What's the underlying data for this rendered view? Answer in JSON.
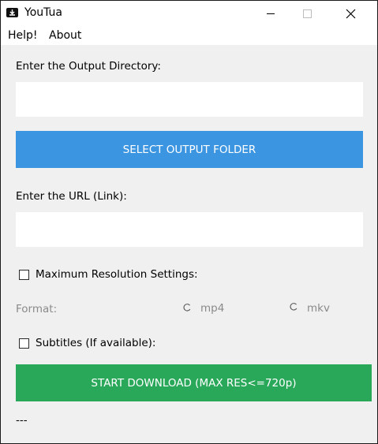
{
  "window": {
    "title": "YouTua"
  },
  "menu": {
    "items": [
      "Help!",
      "About"
    ]
  },
  "output_dir": {
    "label": "Enter the Output Directory:",
    "value": "",
    "button_label": "SELECT OUTPUT FOLDER"
  },
  "url": {
    "label": "Enter the URL (Link):",
    "value": ""
  },
  "max_res": {
    "label": "Maximum Resolution Settings:",
    "checked": false
  },
  "format": {
    "label": "Format:",
    "options": [
      "mp4",
      "mkv"
    ],
    "selected": ""
  },
  "subtitles": {
    "label": "Subtitles (If available):",
    "checked": false
  },
  "download": {
    "button_label": "START DOWNLOAD (MAX RES<=720p)"
  },
  "status": {
    "text": "---"
  },
  "colors": {
    "select_button": "#3c95e1",
    "download_button": "#2aa85a",
    "disabled_text": "#8a8a8a"
  }
}
